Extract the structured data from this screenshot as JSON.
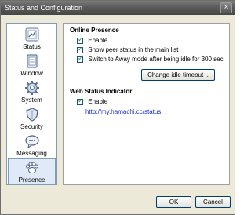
{
  "window": {
    "title": "Status and Configuration",
    "close": "×"
  },
  "sidebar": {
    "items": [
      {
        "label": "Status",
        "icon": "status-icon"
      },
      {
        "label": "Window",
        "icon": "window-icon"
      },
      {
        "label": "System",
        "icon": "gear-icon"
      },
      {
        "label": "Security",
        "icon": "shield-icon"
      },
      {
        "label": "Messaging",
        "icon": "chat-bubble-icon"
      },
      {
        "label": "Presence",
        "icon": "paw-icon",
        "selected": true
      }
    ]
  },
  "online_presence": {
    "title": "Online Presence",
    "enable": {
      "label": "Enable",
      "checked": true
    },
    "show_peer": {
      "label": "Show peer status in the main list",
      "checked": true
    },
    "switch_away": {
      "label": "Switch to Away mode after being idle for 300 sec",
      "checked": true
    },
    "change_button": "Change idle timeout .."
  },
  "web_status": {
    "title": "Web Status Indicator",
    "enable": {
      "label": "Enable",
      "checked": true
    },
    "url": "http://my.hamachi.cc/status"
  },
  "footer": {
    "ok": "OK",
    "cancel": "Cancel"
  }
}
